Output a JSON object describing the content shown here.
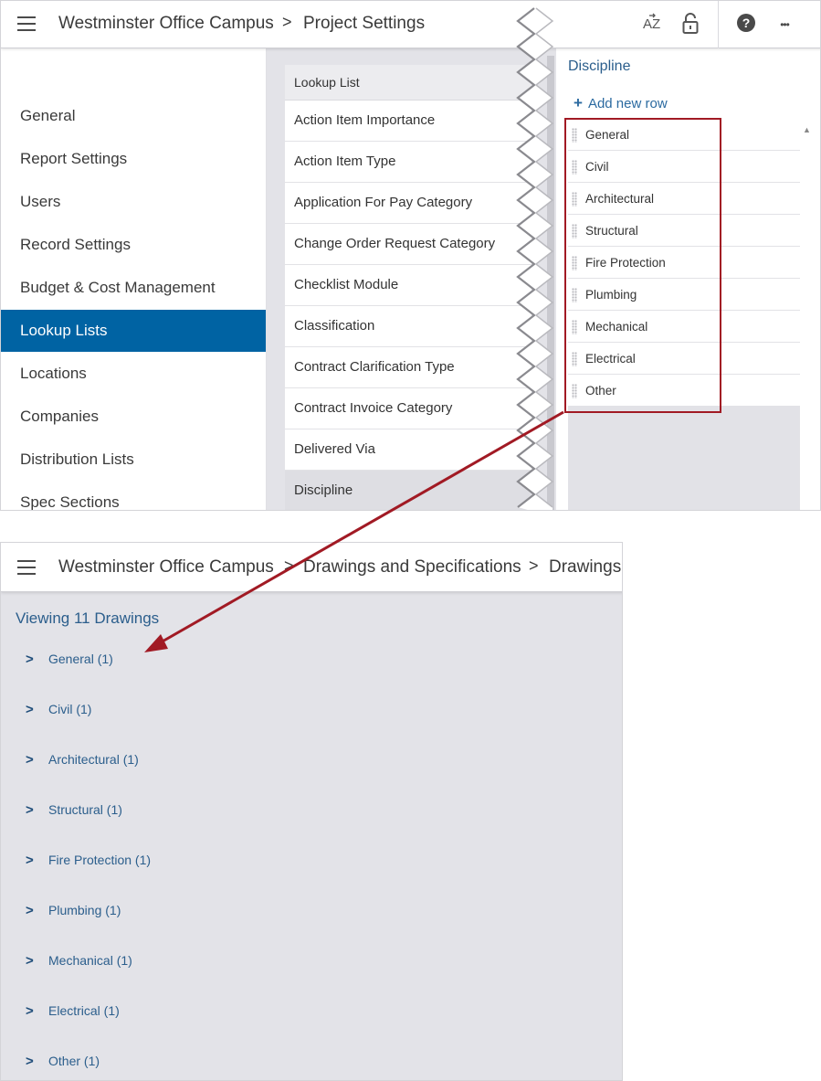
{
  "top": {
    "breadcrumb": [
      "Westminster Office Campus",
      "Project Settings"
    ],
    "separator": ">",
    "icons": [
      "sort-az-icon",
      "lock-icon",
      "help-icon",
      "more-icon"
    ],
    "sort_glyph": "AZ",
    "help_glyph": "?",
    "more_glyph": "•••",
    "nav": [
      "General",
      "Report Settings",
      "Users",
      "Record Settings",
      "Budget & Cost Management",
      "Lookup Lists",
      "Locations",
      "Companies",
      "Distribution Lists",
      "Spec Sections"
    ],
    "nav_active": "Lookup Lists",
    "lookup_header": "Lookup List",
    "lookup_items": [
      "Action Item Importance",
      "Action Item Type",
      "Application For Pay Category",
      "Change Order Request Category",
      "Checklist Module",
      "Classification",
      "Contract Clarification Type",
      "Contract Invoice Category",
      "Delivered Via",
      "Discipline"
    ],
    "lookup_selected": "Discipline",
    "right_title": "Discipline",
    "add_row_label": "Add new row",
    "disciplines": [
      "General",
      "Civil",
      "Architectural",
      "Structural",
      "Fire Protection",
      "Plumbing",
      "Mechanical",
      "Electrical",
      "Other"
    ]
  },
  "bottom": {
    "breadcrumb": [
      "Westminster Office Campus",
      "Drawings and Specifications",
      "Drawings"
    ],
    "separator": ">",
    "viewing": "Viewing 11 Drawings",
    "groups": [
      "General (1)",
      "Civil (1)",
      "Architectural (1)",
      "Structural (1)",
      "Fire Protection (1)",
      "Plumbing (1)",
      "Mechanical (1)",
      "Electrical (1)",
      "Other (1)"
    ],
    "chevron": ">"
  },
  "colors": {
    "accent": "#0063a3",
    "link": "#2b5e8c",
    "annotation": "#a11a24",
    "panel_gray": "#e3e3e8"
  }
}
